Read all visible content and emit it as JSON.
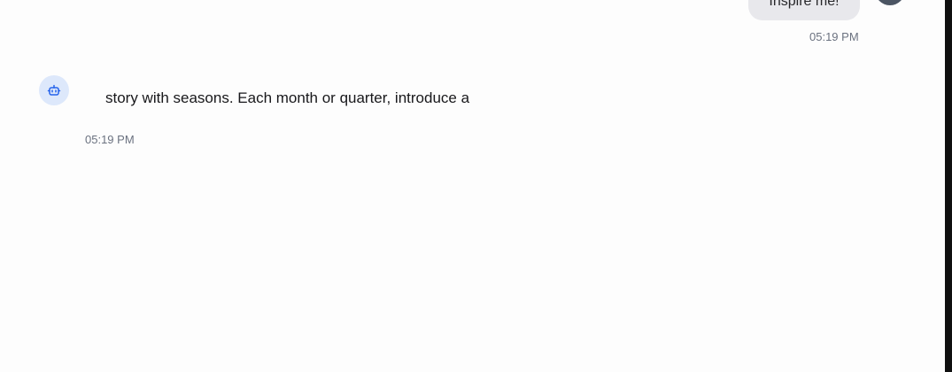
{
  "conversation": {
    "user_message": {
      "text": "Inspire me!",
      "time": "05:19 PM",
      "avatar_icon": "user-avatar"
    },
    "assistant_message": {
      "text": "story with seasons. Each month or quarter, introduce a",
      "time": "05:19 PM",
      "avatar_icon": "robot-icon",
      "avatar_color": "#dde8fb",
      "icon_color": "#2563eb"
    }
  }
}
